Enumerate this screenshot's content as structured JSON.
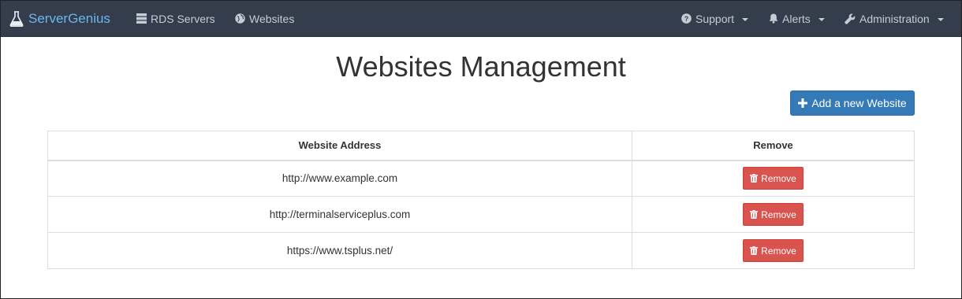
{
  "navbar": {
    "brand": "ServerGenius",
    "links": [
      {
        "label": "RDS Servers",
        "icon": "server-icon"
      },
      {
        "label": "Websites",
        "icon": "globe-icon"
      }
    ],
    "menus": [
      {
        "label": "Support",
        "icon": "question-circle-icon"
      },
      {
        "label": "Alerts",
        "icon": "bell-icon"
      },
      {
        "label": "Administration",
        "icon": "wrench-icon"
      }
    ]
  },
  "page": {
    "title": "Websites Management",
    "add_button": "Add a new Website"
  },
  "table": {
    "headers": {
      "address": "Website Address",
      "remove": "Remove"
    },
    "rows": [
      {
        "address": "http://www.example.com",
        "remove_label": "Remove"
      },
      {
        "address": "http://terminalserviceplus.com",
        "remove_label": "Remove"
      },
      {
        "address": "https://www.tsplus.net/",
        "remove_label": "Remove"
      }
    ]
  },
  "colors": {
    "navbar_bg": "#343d4b",
    "brand": "#6cb6f0",
    "primary": "#337ab7",
    "danger": "#d9534f"
  }
}
